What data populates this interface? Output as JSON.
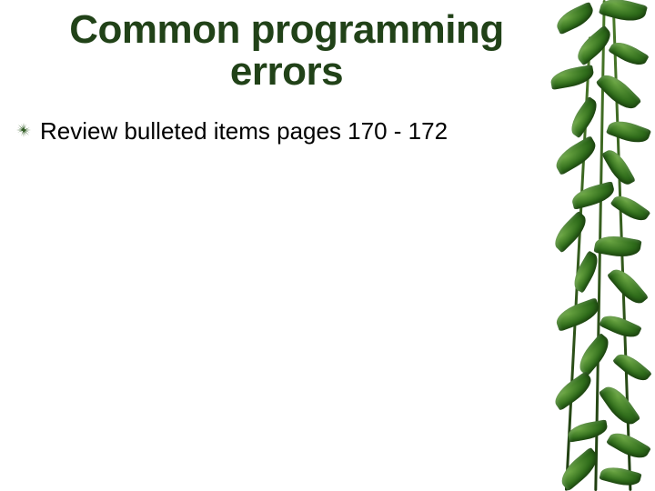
{
  "title": "Common programming errors",
  "bullets": [
    {
      "text": "Review bulleted items pages 170 - 172"
    }
  ],
  "colors": {
    "title": "#214218",
    "bullet_icon": "#2f5a22",
    "body_text": "#000000"
  }
}
